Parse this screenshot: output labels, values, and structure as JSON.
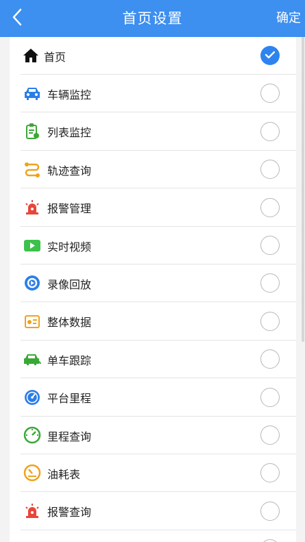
{
  "header": {
    "title": "首页设置",
    "confirm_label": "确定"
  },
  "colors": {
    "header_bg": "#3d8ff0",
    "check_on": "#2d84ef"
  },
  "items": [
    {
      "label": "首页",
      "icon": "home-icon",
      "checked": true
    },
    {
      "label": "车辆监控",
      "icon": "car-monitor-icon",
      "checked": false
    },
    {
      "label": "列表监控",
      "icon": "list-monitor-icon",
      "checked": false
    },
    {
      "label": "轨迹查询",
      "icon": "track-icon",
      "checked": false
    },
    {
      "label": "报警管理",
      "icon": "alarm-icon",
      "checked": false
    },
    {
      "label": "实时视频",
      "icon": "video-icon",
      "checked": false
    },
    {
      "label": "录像回放",
      "icon": "playback-icon",
      "checked": false
    },
    {
      "label": "整体数据",
      "icon": "data-card-icon",
      "checked": false
    },
    {
      "label": "单车跟踪",
      "icon": "car-tracking-icon",
      "checked": false
    },
    {
      "label": "平台里程",
      "icon": "speedometer-icon",
      "checked": false
    },
    {
      "label": "里程查询",
      "icon": "mileage-gauge-icon",
      "checked": false
    },
    {
      "label": "油耗表",
      "icon": "fuel-gauge-icon",
      "checked": false
    },
    {
      "label": "报警查询",
      "icon": "alarm-query-icon",
      "checked": false
    },
    {
      "label": "",
      "icon": "partial-icon",
      "checked": false
    }
  ]
}
